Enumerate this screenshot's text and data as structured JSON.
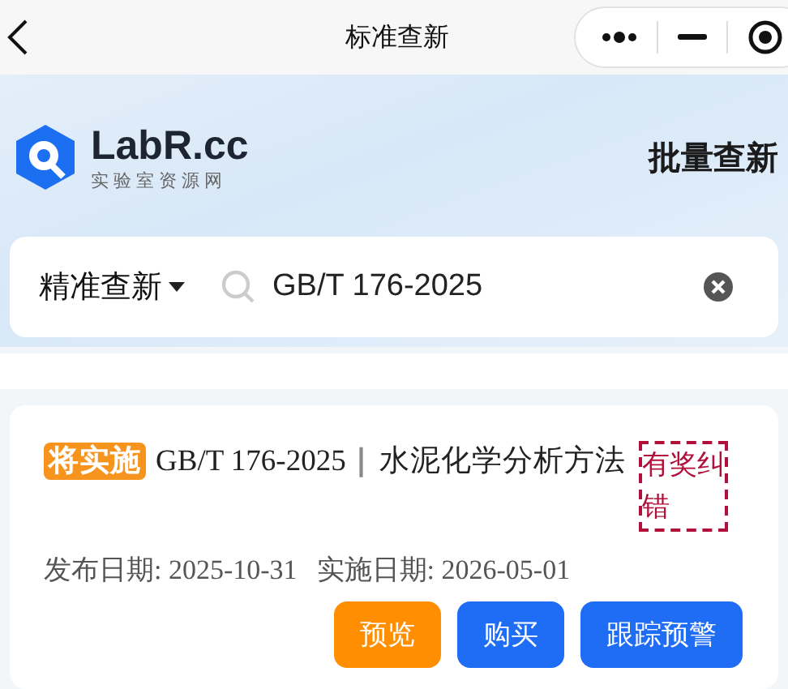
{
  "nav": {
    "title": "标准查新"
  },
  "header": {
    "logo_title": "LabR.cc",
    "logo_subtitle": "实验室资源网",
    "batch_link": "批量查新"
  },
  "search": {
    "mode": "精准查新",
    "value": "GB/T 176-2025"
  },
  "results": [
    {
      "status": "将实施",
      "code": "GB/T 176-2025",
      "separator": "|",
      "title": "水泥化学分析方法",
      "report_link": "有奖纠错",
      "publish_date": "发布日期: 2025-10-31",
      "implement_date": "实施日期: 2026-05-01",
      "buttons": [
        {
          "label": "预览",
          "kind": "secondary"
        },
        {
          "label": "购买",
          "kind": "primary"
        },
        {
          "label": "跟踪预警",
          "kind": "primary"
        }
      ]
    }
  ]
}
